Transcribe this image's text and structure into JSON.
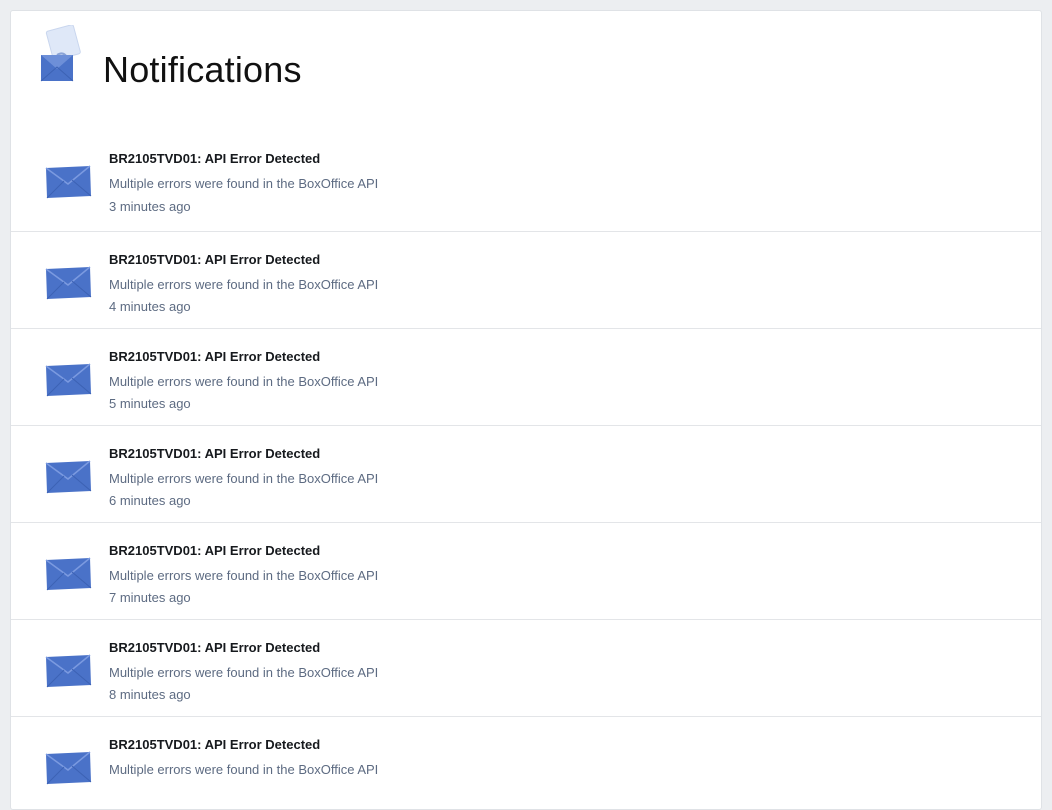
{
  "page": {
    "title": "Notifications",
    "header_icon": "open-envelope-letter-icon",
    "item_icon": "envelope-icon"
  },
  "colors": {
    "envelope_blue": "#4a72c8",
    "envelope_light": "#7b9ae0",
    "muted_text": "#5d6b82"
  },
  "notifications": [
    {
      "title": "BR2105TVD01: API Error Detected",
      "description": "Multiple errors were found in the BoxOffice API",
      "time": "3 minutes ago"
    },
    {
      "title": "BR2105TVD01: API Error Detected",
      "description": "Multiple errors were found in the BoxOffice API",
      "time": "4 minutes ago"
    },
    {
      "title": "BR2105TVD01: API Error Detected",
      "description": "Multiple errors were found in the BoxOffice API",
      "time": "5 minutes ago"
    },
    {
      "title": "BR2105TVD01: API Error Detected",
      "description": "Multiple errors were found in the BoxOffice API",
      "time": "6 minutes ago"
    },
    {
      "title": "BR2105TVD01: API Error Detected",
      "description": "Multiple errors were found in the BoxOffice API",
      "time": "7 minutes ago"
    },
    {
      "title": "BR2105TVD01: API Error Detected",
      "description": "Multiple errors were found in the BoxOffice API",
      "time": "8 minutes ago"
    },
    {
      "title": "BR2105TVD01: API Error Detected",
      "description": "Multiple errors were found in the BoxOffice API",
      "time": ""
    }
  ]
}
